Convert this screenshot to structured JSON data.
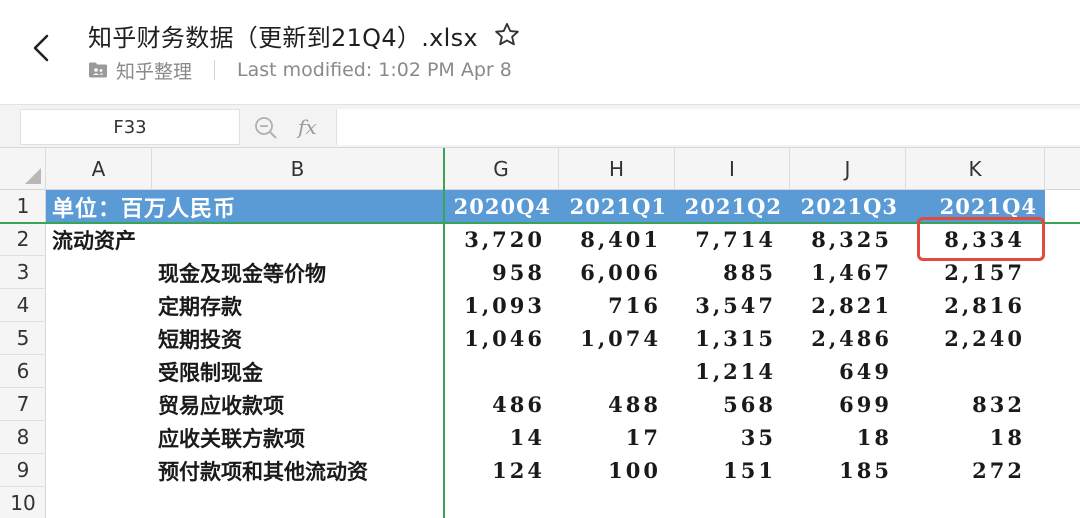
{
  "header": {
    "title": "知乎财务数据（更新到21Q4）.xlsx",
    "owner": "知乎整理",
    "modified": "Last modified: 1:02 PM Apr 8"
  },
  "formula_bar": {
    "cell_ref": "F33",
    "fx_label": "fx"
  },
  "columns": [
    "A",
    "B",
    "G",
    "H",
    "I",
    "J",
    "K"
  ],
  "rows": [
    "1",
    "2",
    "3",
    "4",
    "5",
    "6",
    "7",
    "8",
    "9",
    "10"
  ],
  "sheet": {
    "unit_label": "单位：百万人民币",
    "periods": [
      "2020Q4",
      "2021Q1",
      "2021Q2",
      "2021Q3",
      "2021Q4"
    ],
    "lines": [
      {
        "label": "流动资产",
        "values": [
          "3,720",
          "8,401",
          "7,714",
          "8,325",
          "8,334"
        ]
      },
      {
        "label": "现金及现金等价物",
        "values": [
          "958",
          "6,006",
          "885",
          "1,467",
          "2,157"
        ]
      },
      {
        "label": "定期存款",
        "values": [
          "1,093",
          "716",
          "3,547",
          "2,821",
          "2,816"
        ]
      },
      {
        "label": "短期投资",
        "values": [
          "1,046",
          "1,074",
          "1,315",
          "2,486",
          "2,240"
        ]
      },
      {
        "label": "受限制现金",
        "values": [
          "",
          "",
          "1,214",
          "649",
          ""
        ]
      },
      {
        "label": "贸易应收款项",
        "values": [
          "486",
          "488",
          "568",
          "699",
          "832"
        ]
      },
      {
        "label": "应收关联方款项",
        "values": [
          "14",
          "17",
          "35",
          "18",
          "18"
        ]
      },
      {
        "label": "预付款项和其他流动资",
        "values": [
          "124",
          "100",
          "151",
          "185",
          "272"
        ]
      }
    ]
  },
  "colors": {
    "header_fill": "#5b9bd5",
    "freeze_line": "#3aa35a",
    "highlight_border": "#e04a3f"
  }
}
